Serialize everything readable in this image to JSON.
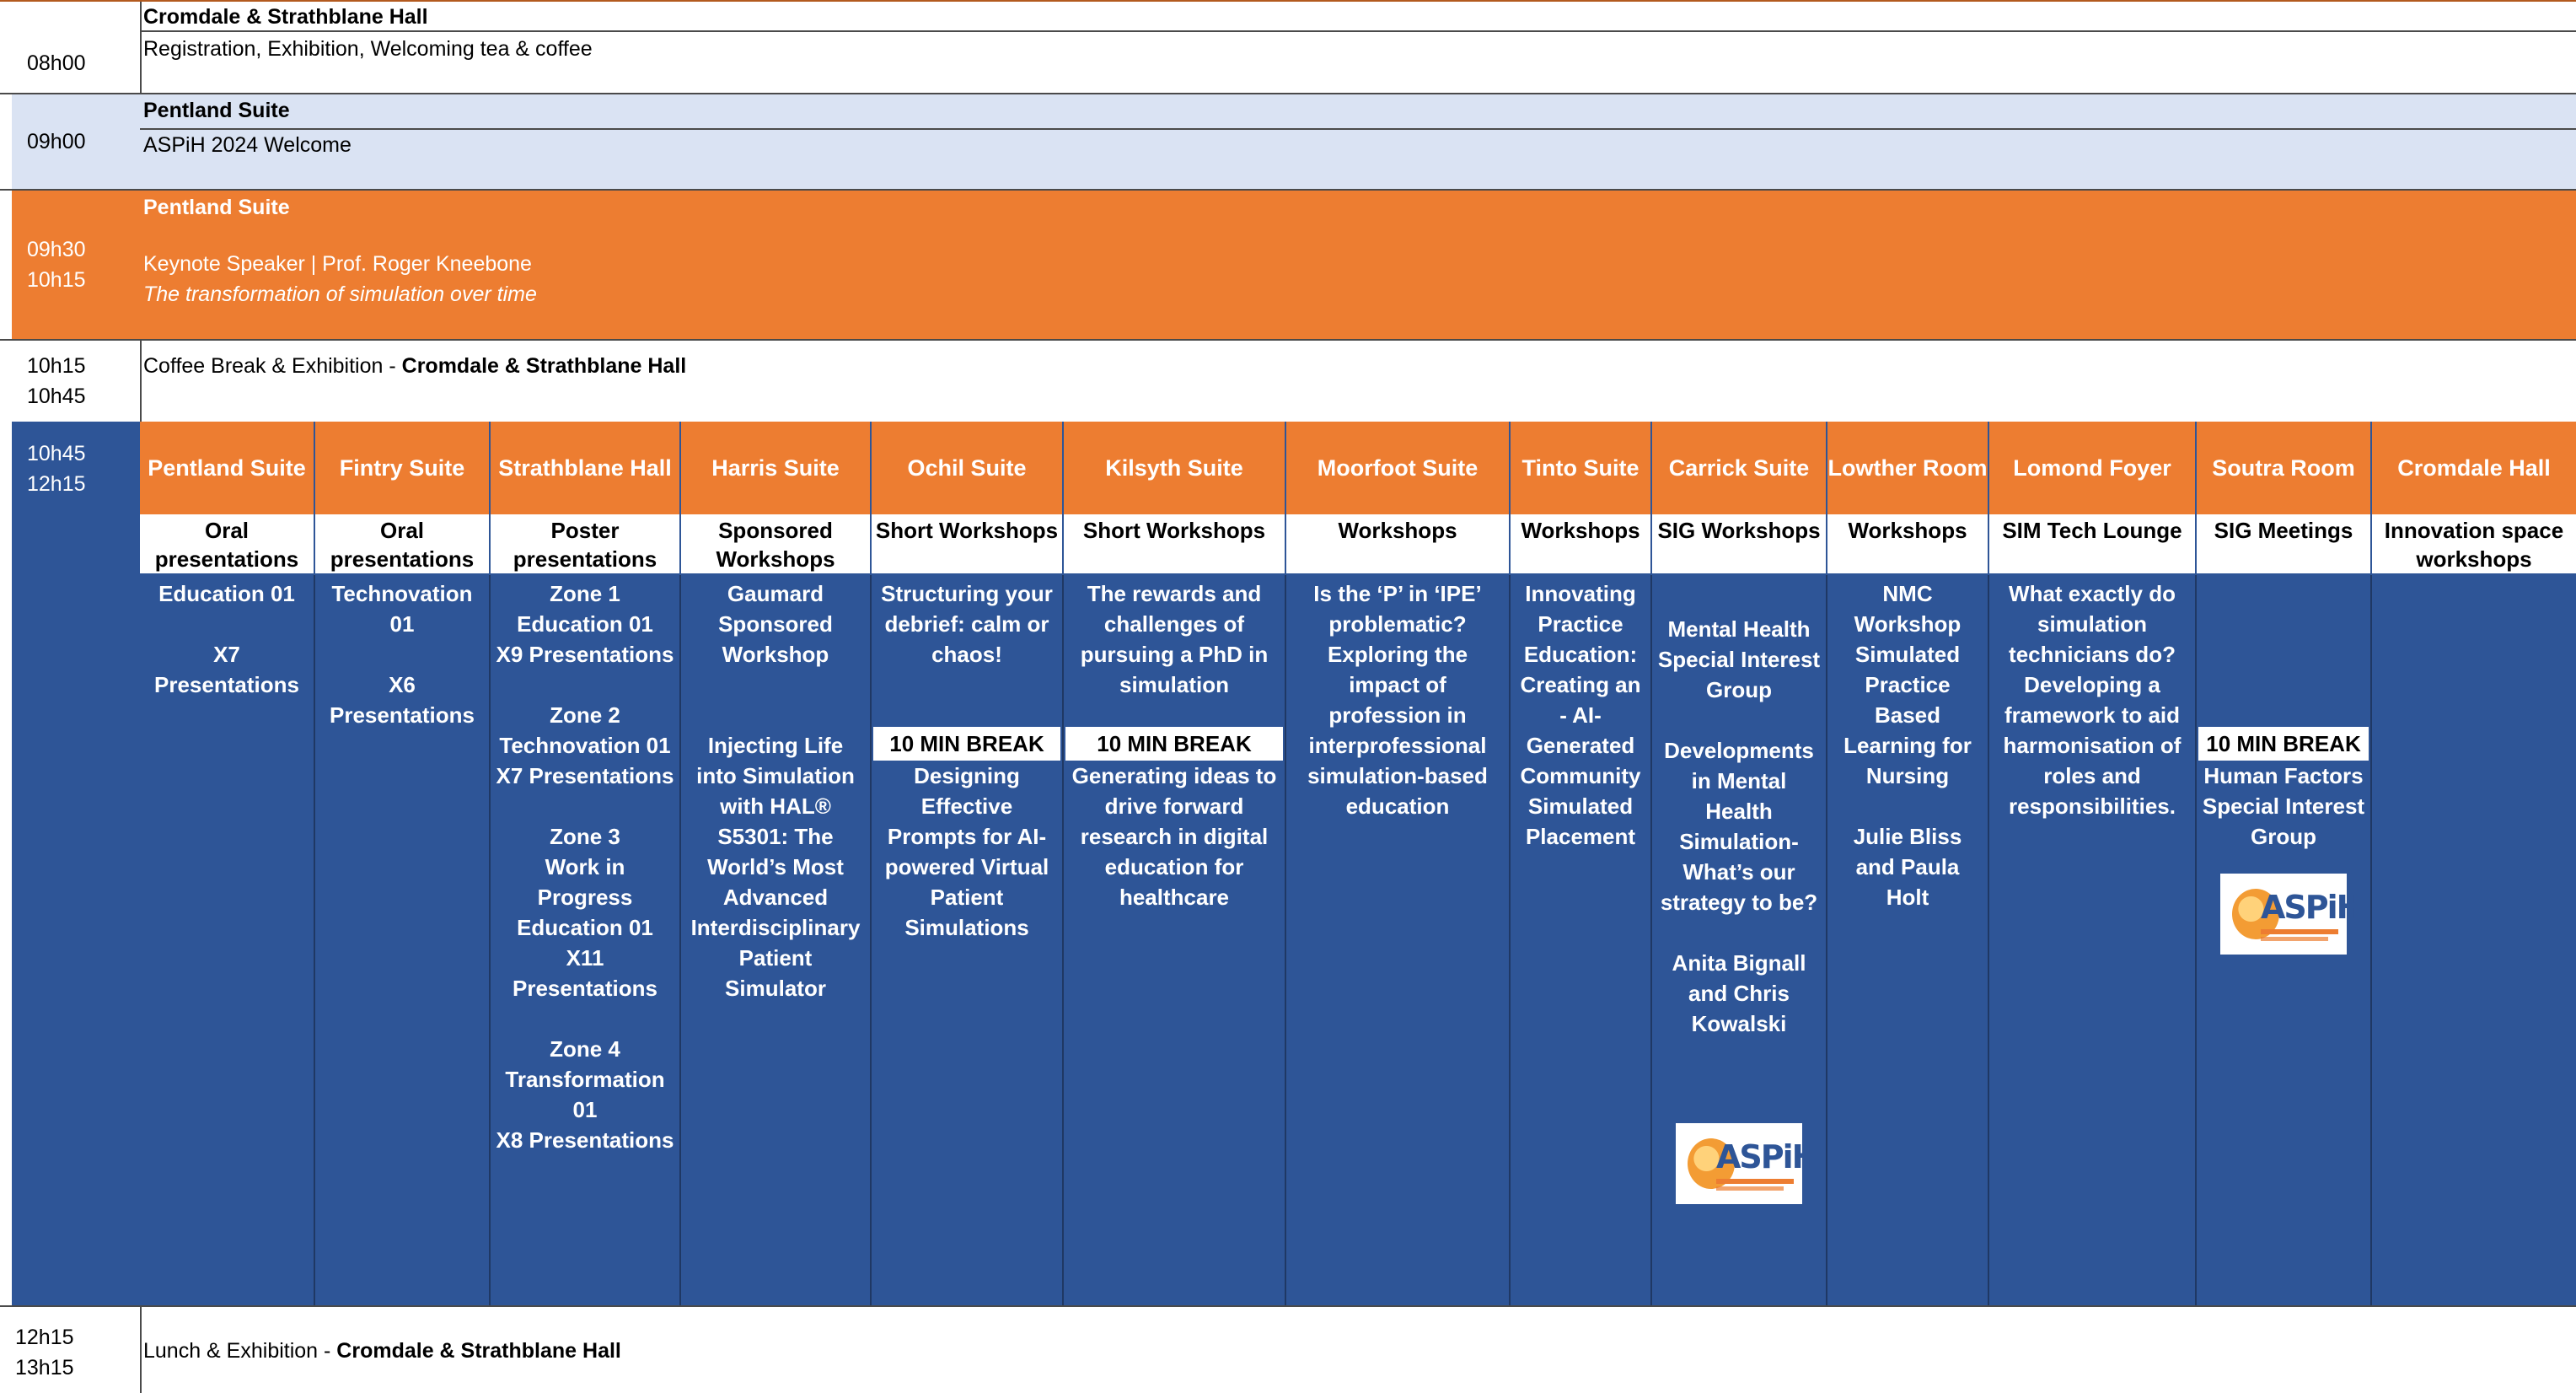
{
  "rows": {
    "r1": {
      "time": [
        "08h00"
      ],
      "venue": "Cromdale & Strathblane Hall",
      "text": "Registration, Exhibition, Welcoming tea & coffee"
    },
    "r2": {
      "time": [
        "09h00"
      ],
      "venue": "Pentland Suite",
      "text": "ASPiH 2024 Welcome"
    },
    "r3": {
      "time": [
        "09h30",
        "10h15"
      ],
      "venue": "Pentland Suite",
      "speaker": "Keynote Speaker | Prof. Roger Kneebone",
      "talk": "The transformation of simulation over time"
    },
    "r4": {
      "time": [
        "10h15",
        "10h45"
      ],
      "text": "Coffee Break & Exhibition - ",
      "venue": "Cromdale & Strathblane Hall"
    },
    "r5": {
      "time": [
        "10h45",
        "12h15"
      ]
    },
    "r6": {
      "time": [
        "12h15",
        "13h15"
      ],
      "text": "Lunch & Exhibition - ",
      "venue": "Cromdale & Strathblane Hall"
    }
  },
  "colors": {
    "orange": "#ed7d31",
    "navy": "#2e5597",
    "light_blue": "#dae3f3"
  },
  "logo_text": "ASPiH",
  "columns": [
    {
      "room": "Pentland Suite",
      "type": "Oral presentations",
      "body": "Education 01\n\nX7\nPresentations"
    },
    {
      "room": "Fintry Suite",
      "type": "Oral presentations",
      "body": "Technovation 01\n\nX6\nPresentations"
    },
    {
      "room": "Strathblane Hall",
      "type": "Poster presentations",
      "body": "Zone 1\nEducation 01\nX9 Presentations\n\nZone 2\nTechnovation 01\nX7 Presentations\n\nZone 3\nWork in Progress\nEducation 01\nX11\nPresentations\n\nZone 4\nTransformation\n01\nX8 Presentations"
    },
    {
      "room": "Harris Suite",
      "type": "Sponsored Workshops",
      "body": "Gaumard Sponsored Workshop\n\n\nInjecting Life into Simulation with HAL® S5301: The World’s Most Advanced Interdisciplinary Patient Simulator"
    },
    {
      "room": "Ochil Suite",
      "type": "Short Workshops",
      "body_before": "Structuring your debrief: calm or chaos!",
      "break": "10 MIN BREAK",
      "body_after": "Designing Effective Prompts for AI-powered Virtual Patient Simulations"
    },
    {
      "room": "Kilsyth Suite",
      "type": "Short Workshops",
      "body_before": "The rewards and challenges of pursuing a PhD in simulation",
      "break": "10 MIN BREAK",
      "body_after": "Generating ideas to drive forward research in digital education for healthcare"
    },
    {
      "room": "Moorfoot Suite",
      "type": "Workshops",
      "body": "Is the ‘P’ in ‘IPE’ problematic? Exploring the impact of profession in interprofessional simulation-based education"
    },
    {
      "room": "Tinto Suite",
      "type": "Workshops",
      "body": "Innovating Practice Education: Creating an - AI-Generated Community Simulated Placement"
    },
    {
      "room": "Carrick Suite",
      "type": "SIG Workshops",
      "body": "Mental Health Special Interest Group\n\nDevelopments in Mental Health Simulation- What’s our strategy to be?\n\nAnita Bignall and Chris Kowalski"
    },
    {
      "room": "Lowther Room",
      "type": "Workshops",
      "body": "NMC Workshop Simulated Practice Based Learning for Nursing\n\nJulie Bliss and Paula Holt"
    },
    {
      "room": "Lomond Foyer",
      "type": "SIM Tech Lounge",
      "body": "What exactly do simulation technicians do? Developing a framework to aid harmonisation of roles and responsibilities."
    },
    {
      "room": "Soutra Room",
      "type": "SIG Meetings",
      "break": "10 MIN BREAK",
      "body_after": "Human Factors Special Interest Group"
    },
    {
      "room": "Cromdale Hall",
      "type": "Innovation space workshops",
      "body": ""
    }
  ]
}
